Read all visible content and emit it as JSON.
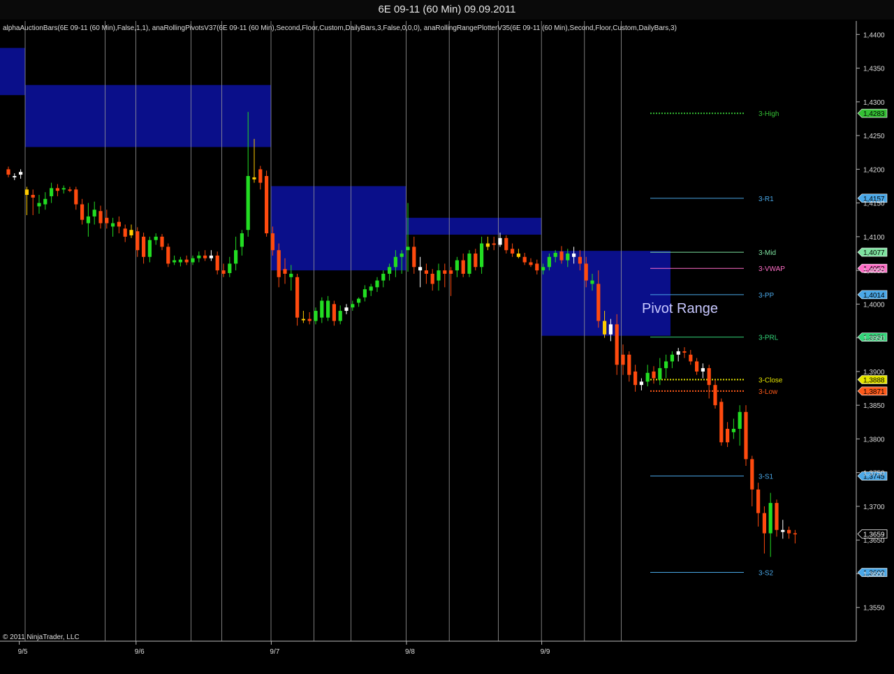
{
  "window": {
    "title": "6E 09-11 (60 Min)  09.09.2011"
  },
  "indicator_text": "alphaAuctionBars(6E 09-11 (60 Min),False,1,1), anaRollingPivotsV37(6E 09-11 (60 Min),Second,Floor,Custom,DailyBars,3,False,0,0,0), anaRollingRangePlotterV35(6E 09-11 (60 Min),Second,Floor,Custom,DailyBars,3)",
  "copyright": "© 2011 NinjaTrader, LLC",
  "annotation": "Pivot Range",
  "chart_data": {
    "type": "candlestick",
    "title": "6E 09-11 (60 Min)  09.09.2011",
    "y_axis": {
      "range": [
        1.35,
        1.442
      ],
      "ticks": [
        1.355,
        1.36,
        1.365,
        1.37,
        1.375,
        1.38,
        1.385,
        1.39,
        1.395,
        1.4,
        1.405,
        1.41,
        1.415,
        1.42,
        1.425,
        1.43,
        1.435,
        1.44
      ],
      "tick_labels": [
        "1,3550",
        "1,3600",
        "1,3650",
        "1,3700",
        "1,3750",
        "1,3800",
        "1,3850",
        "1,3900",
        "1,3950",
        "1,4000",
        "1,4050",
        "1,4100",
        "1,4150",
        "1,4200",
        "1,4250",
        "1,4300",
        "1,4350",
        "1,4400"
      ]
    },
    "x_axis": {
      "bar_count": 122,
      "date_labels": [
        {
          "label": "9/5",
          "bar": 2
        },
        {
          "label": "9/6",
          "bar": 21
        },
        {
          "label": "9/7",
          "bar": 43
        },
        {
          "label": "9/8",
          "bar": 65
        },
        {
          "label": "9/9",
          "bar": 87
        }
      ],
      "session_lines_bars": [
        3,
        16,
        21,
        30,
        35,
        43,
        50,
        56,
        65,
        72,
        80,
        87,
        94,
        100
      ]
    },
    "candles": [
      {
        "o": 1.42,
        "h": 1.4204,
        "l": 1.4188,
        "c": 1.4192,
        "color": "red"
      },
      {
        "o": 1.419,
        "h": 1.4194,
        "l": 1.4184,
        "c": 1.4188,
        "color": "white"
      },
      {
        "o": 1.4192,
        "h": 1.42,
        "l": 1.4186,
        "c": 1.4196,
        "color": "white"
      },
      {
        "o": 1.417,
        "h": 1.4174,
        "l": 1.4132,
        "c": 1.4162,
        "color": "yellow"
      },
      {
        "o": 1.4162,
        "h": 1.417,
        "l": 1.4132,
        "c": 1.4158,
        "color": "red"
      },
      {
        "o": 1.415,
        "h": 1.4162,
        "l": 1.4134,
        "c": 1.4145,
        "color": "green"
      },
      {
        "o": 1.4148,
        "h": 1.4166,
        "l": 1.414,
        "c": 1.4156,
        "color": "green"
      },
      {
        "o": 1.416,
        "h": 1.418,
        "l": 1.415,
        "c": 1.4172,
        "color": "green"
      },
      {
        "o": 1.4172,
        "h": 1.4178,
        "l": 1.416,
        "c": 1.4168,
        "color": "red"
      },
      {
        "o": 1.417,
        "h": 1.4176,
        "l": 1.4164,
        "c": 1.4172,
        "color": "green"
      },
      {
        "o": 1.417,
        "h": 1.4174,
        "l": 1.4166,
        "c": 1.4168,
        "color": "red"
      },
      {
        "o": 1.417,
        "h": 1.4174,
        "l": 1.414,
        "c": 1.4148,
        "color": "red"
      },
      {
        "o": 1.4148,
        "h": 1.4156,
        "l": 1.4118,
        "c": 1.4125,
        "color": "red"
      },
      {
        "o": 1.412,
        "h": 1.415,
        "l": 1.41,
        "c": 1.413,
        "color": "green"
      },
      {
        "o": 1.413,
        "h": 1.4152,
        "l": 1.4118,
        "c": 1.414,
        "color": "green"
      },
      {
        "o": 1.4138,
        "h": 1.4146,
        "l": 1.4112,
        "c": 1.412,
        "color": "red"
      },
      {
        "o": 1.4128,
        "h": 1.414,
        "l": 1.4112,
        "c": 1.412,
        "color": "red"
      },
      {
        "o": 1.412,
        "h": 1.4128,
        "l": 1.41,
        "c": 1.4115,
        "color": "green"
      },
      {
        "o": 1.4122,
        "h": 1.413,
        "l": 1.4105,
        "c": 1.4115,
        "color": "red"
      },
      {
        "o": 1.4112,
        "h": 1.4118,
        "l": 1.4092,
        "c": 1.41,
        "color": "red"
      },
      {
        "o": 1.411,
        "h": 1.4118,
        "l": 1.4098,
        "c": 1.4102,
        "color": "yellow"
      },
      {
        "o": 1.4108,
        "h": 1.4114,
        "l": 1.407,
        "c": 1.408,
        "color": "red"
      },
      {
        "o": 1.41,
        "h": 1.4106,
        "l": 1.406,
        "c": 1.407,
        "color": "red"
      },
      {
        "o": 1.407,
        "h": 1.41,
        "l": 1.4062,
        "c": 1.4095,
        "color": "green"
      },
      {
        "o": 1.4095,
        "h": 1.4105,
        "l": 1.4088,
        "c": 1.41,
        "color": "green"
      },
      {
        "o": 1.41,
        "h": 1.4104,
        "l": 1.408,
        "c": 1.4085,
        "color": "red"
      },
      {
        "o": 1.4085,
        "h": 1.409,
        "l": 1.4055,
        "c": 1.406,
        "color": "red"
      },
      {
        "o": 1.4065,
        "h": 1.4072,
        "l": 1.4058,
        "c": 1.4062,
        "color": "green"
      },
      {
        "o": 1.4062,
        "h": 1.407,
        "l": 1.4056,
        "c": 1.4066,
        "color": "green"
      },
      {
        "o": 1.4066,
        "h": 1.4072,
        "l": 1.4058,
        "c": 1.4062,
        "color": "red"
      },
      {
        "o": 1.4062,
        "h": 1.4072,
        "l": 1.4058,
        "c": 1.4068,
        "color": "green"
      },
      {
        "o": 1.4068,
        "h": 1.4078,
        "l": 1.4062,
        "c": 1.4072,
        "color": "green"
      },
      {
        "o": 1.4072,
        "h": 1.408,
        "l": 1.4064,
        "c": 1.4068,
        "color": "red"
      },
      {
        "o": 1.4068,
        "h": 1.408,
        "l": 1.4064,
        "c": 1.4072,
        "color": "white"
      },
      {
        "o": 1.4072,
        "h": 1.4078,
        "l": 1.4044,
        "c": 1.405,
        "color": "red"
      },
      {
        "o": 1.405,
        "h": 1.406,
        "l": 1.404,
        "c": 1.4045,
        "color": "red"
      },
      {
        "o": 1.4046,
        "h": 1.407,
        "l": 1.404,
        "c": 1.406,
        "color": "green"
      },
      {
        "o": 1.406,
        "h": 1.41,
        "l": 1.405,
        "c": 1.408,
        "color": "green"
      },
      {
        "o": 1.4085,
        "h": 1.411,
        "l": 1.4072,
        "c": 1.4105,
        "color": "green"
      },
      {
        "o": 1.411,
        "h": 1.4285,
        "l": 1.41,
        "c": 1.419,
        "color": "green"
      },
      {
        "o": 1.4188,
        "h": 1.4245,
        "l": 1.418,
        "c": 1.4185,
        "color": "yellow"
      },
      {
        "o": 1.42,
        "h": 1.4205,
        "l": 1.417,
        "c": 1.418,
        "color": "red"
      },
      {
        "o": 1.419,
        "h": 1.4198,
        "l": 1.41,
        "c": 1.4105,
        "color": "red"
      },
      {
        "o": 1.4105,
        "h": 1.4115,
        "l": 1.4072,
        "c": 1.408,
        "color": "red"
      },
      {
        "o": 1.408,
        "h": 1.409,
        "l": 1.4025,
        "c": 1.404,
        "color": "red"
      },
      {
        "o": 1.4052,
        "h": 1.4068,
        "l": 1.403,
        "c": 1.4045,
        "color": "red"
      },
      {
        "o": 1.4045,
        "h": 1.4058,
        "l": 1.402,
        "c": 1.404,
        "color": "green"
      },
      {
        "o": 1.404,
        "h": 1.4045,
        "l": 1.3968,
        "c": 1.398,
        "color": "red"
      },
      {
        "o": 1.3978,
        "h": 1.399,
        "l": 1.3972,
        "c": 1.3976,
        "color": "yellow"
      },
      {
        "o": 1.3978,
        "h": 1.3988,
        "l": 1.397,
        "c": 1.3975,
        "color": "red"
      },
      {
        "o": 1.3975,
        "h": 1.3995,
        "l": 1.397,
        "c": 1.399,
        "color": "green"
      },
      {
        "o": 1.398,
        "h": 1.401,
        "l": 1.3972,
        "c": 1.4005,
        "color": "green"
      },
      {
        "o": 1.4005,
        "h": 1.4012,
        "l": 1.3975,
        "c": 1.398,
        "color": "green"
      },
      {
        "o": 1.4,
        "h": 1.4005,
        "l": 1.3968,
        "c": 1.3975,
        "color": "red"
      },
      {
        "o": 1.3975,
        "h": 1.3998,
        "l": 1.397,
        "c": 1.399,
        "color": "green"
      },
      {
        "o": 1.399,
        "h": 1.4,
        "l": 1.3985,
        "c": 1.3995,
        "color": "white"
      },
      {
        "o": 1.3995,
        "h": 1.4005,
        "l": 1.399,
        "c": 1.4,
        "color": "green"
      },
      {
        "o": 1.4002,
        "h": 1.401,
        "l": 1.3996,
        "c": 1.4008,
        "color": "green"
      },
      {
        "o": 1.401,
        "h": 1.4028,
        "l": 1.4004,
        "c": 1.4022,
        "color": "green"
      },
      {
        "o": 1.402,
        "h": 1.403,
        "l": 1.4012,
        "c": 1.4026,
        "color": "green"
      },
      {
        "o": 1.4025,
        "h": 1.404,
        "l": 1.4018,
        "c": 1.4035,
        "color": "green"
      },
      {
        "o": 1.4035,
        "h": 1.405,
        "l": 1.4025,
        "c": 1.4045,
        "color": "green"
      },
      {
        "o": 1.4045,
        "h": 1.406,
        "l": 1.4035,
        "c": 1.4055,
        "color": "green"
      },
      {
        "o": 1.4055,
        "h": 1.408,
        "l": 1.404,
        "c": 1.407,
        "color": "green"
      },
      {
        "o": 1.407,
        "h": 1.408,
        "l": 1.4045,
        "c": 1.4075,
        "color": "green"
      },
      {
        "o": 1.408,
        "h": 1.415,
        "l": 1.4048,
        "c": 1.4085,
        "color": "green"
      },
      {
        "o": 1.4085,
        "h": 1.41,
        "l": 1.4045,
        "c": 1.4055,
        "color": "red"
      },
      {
        "o": 1.4055,
        "h": 1.407,
        "l": 1.4025,
        "c": 1.405,
        "color": "white"
      },
      {
        "o": 1.405,
        "h": 1.406,
        "l": 1.403,
        "c": 1.4045,
        "color": "red"
      },
      {
        "o": 1.4045,
        "h": 1.4052,
        "l": 1.402,
        "c": 1.403,
        "color": "red"
      },
      {
        "o": 1.4035,
        "h": 1.406,
        "l": 1.402,
        "c": 1.405,
        "color": "green"
      },
      {
        "o": 1.405,
        "h": 1.406,
        "l": 1.4025,
        "c": 1.4045,
        "color": "red"
      },
      {
        "o": 1.4045,
        "h": 1.4055,
        "l": 1.4012,
        "c": 1.405,
        "color": "red"
      },
      {
        "o": 1.405,
        "h": 1.407,
        "l": 1.404,
        "c": 1.4065,
        "color": "green"
      },
      {
        "o": 1.4065,
        "h": 1.4075,
        "l": 1.404,
        "c": 1.4045,
        "color": "red"
      },
      {
        "o": 1.4045,
        "h": 1.408,
        "l": 1.404,
        "c": 1.4075,
        "color": "green"
      },
      {
        "o": 1.4075,
        "h": 1.4082,
        "l": 1.405,
        "c": 1.4055,
        "color": "red"
      },
      {
        "o": 1.4055,
        "h": 1.41,
        "l": 1.4045,
        "c": 1.409,
        "color": "green"
      },
      {
        "o": 1.409,
        "h": 1.41,
        "l": 1.408,
        "c": 1.4085,
        "color": "yellow"
      },
      {
        "o": 1.4088,
        "h": 1.41,
        "l": 1.408,
        "c": 1.409,
        "color": "red"
      },
      {
        "o": 1.4088,
        "h": 1.4106,
        "l": 1.4085,
        "c": 1.4098,
        "color": "white"
      },
      {
        "o": 1.4098,
        "h": 1.4102,
        "l": 1.4075,
        "c": 1.408,
        "color": "red"
      },
      {
        "o": 1.4082,
        "h": 1.409,
        "l": 1.407,
        "c": 1.4075,
        "color": "red"
      },
      {
        "o": 1.4075,
        "h": 1.4082,
        "l": 1.4068,
        "c": 1.407,
        "color": "yellow"
      },
      {
        "o": 1.407,
        "h": 1.4076,
        "l": 1.4058,
        "c": 1.4062,
        "color": "red"
      },
      {
        "o": 1.4062,
        "h": 1.4068,
        "l": 1.4055,
        "c": 1.4058,
        "color": "red"
      },
      {
        "o": 1.406,
        "h": 1.4066,
        "l": 1.4044,
        "c": 1.405,
        "color": "red"
      },
      {
        "o": 1.405,
        "h": 1.406,
        "l": 1.4044,
        "c": 1.4055,
        "color": "green"
      },
      {
        "o": 1.4055,
        "h": 1.4075,
        "l": 1.405,
        "c": 1.407,
        "color": "green"
      },
      {
        "o": 1.407,
        "h": 1.408,
        "l": 1.4062,
        "c": 1.4076,
        "color": "green"
      },
      {
        "o": 1.4078,
        "h": 1.4086,
        "l": 1.406,
        "c": 1.4065,
        "color": "red"
      },
      {
        "o": 1.4065,
        "h": 1.4082,
        "l": 1.4055,
        "c": 1.4075,
        "color": "green"
      },
      {
        "o": 1.4075,
        "h": 1.4085,
        "l": 1.406,
        "c": 1.407,
        "color": "white"
      },
      {
        "o": 1.407,
        "h": 1.408,
        "l": 1.405,
        "c": 1.406,
        "color": "red"
      },
      {
        "o": 1.406,
        "h": 1.407,
        "l": 1.4025,
        "c": 1.4035,
        "color": "red"
      },
      {
        "o": 1.4035,
        "h": 1.4045,
        "l": 1.402,
        "c": 1.403,
        "color": "green"
      },
      {
        "o": 1.403,
        "h": 1.405,
        "l": 1.3965,
        "c": 1.3975,
        "color": "red"
      },
      {
        "o": 1.3975,
        "h": 1.399,
        "l": 1.395,
        "c": 1.3955,
        "color": "yellow"
      },
      {
        "o": 1.3955,
        "h": 1.3978,
        "l": 1.3945,
        "c": 1.397,
        "color": "white"
      },
      {
        "o": 1.397,
        "h": 1.3985,
        "l": 1.3895,
        "c": 1.391,
        "color": "red"
      },
      {
        "o": 1.391,
        "h": 1.394,
        "l": 1.3895,
        "c": 1.3925,
        "color": "red"
      },
      {
        "o": 1.3925,
        "h": 1.393,
        "l": 1.3885,
        "c": 1.3895,
        "color": "red"
      },
      {
        "o": 1.39,
        "h": 1.391,
        "l": 1.387,
        "c": 1.388,
        "color": "red"
      },
      {
        "o": 1.388,
        "h": 1.389,
        "l": 1.3872,
        "c": 1.3885,
        "color": "white"
      },
      {
        "o": 1.3885,
        "h": 1.391,
        "l": 1.3878,
        "c": 1.3898,
        "color": "green"
      },
      {
        "o": 1.39,
        "h": 1.3908,
        "l": 1.3882,
        "c": 1.389,
        "color": "red"
      },
      {
        "o": 1.3888,
        "h": 1.392,
        "l": 1.388,
        "c": 1.3905,
        "color": "green"
      },
      {
        "o": 1.3905,
        "h": 1.3925,
        "l": 1.389,
        "c": 1.3915,
        "color": "green"
      },
      {
        "o": 1.3915,
        "h": 1.393,
        "l": 1.3905,
        "c": 1.3925,
        "color": "green"
      },
      {
        "o": 1.3925,
        "h": 1.3935,
        "l": 1.3915,
        "c": 1.393,
        "color": "white"
      },
      {
        "o": 1.393,
        "h": 1.3936,
        "l": 1.392,
        "c": 1.3928,
        "color": "red"
      },
      {
        "o": 1.3925,
        "h": 1.3932,
        "l": 1.391,
        "c": 1.3915,
        "color": "red"
      },
      {
        "o": 1.3915,
        "h": 1.392,
        "l": 1.3895,
        "c": 1.39,
        "color": "red"
      },
      {
        "o": 1.39,
        "h": 1.3912,
        "l": 1.389,
        "c": 1.3905,
        "color": "white"
      },
      {
        "o": 1.3905,
        "h": 1.391,
        "l": 1.386,
        "c": 1.388,
        "color": "red"
      },
      {
        "o": 1.388,
        "h": 1.3888,
        "l": 1.3845,
        "c": 1.385,
        "color": "red"
      },
      {
        "o": 1.3855,
        "h": 1.386,
        "l": 1.379,
        "c": 1.3795,
        "color": "red"
      },
      {
        "o": 1.3795,
        "h": 1.3825,
        "l": 1.3788,
        "c": 1.3815,
        "color": "red"
      },
      {
        "o": 1.3815,
        "h": 1.383,
        "l": 1.38,
        "c": 1.381,
        "color": "green"
      },
      {
        "o": 1.3815,
        "h": 1.385,
        "l": 1.379,
        "c": 1.384,
        "color": "green"
      },
      {
        "o": 1.384,
        "h": 1.385,
        "l": 1.376,
        "c": 1.377,
        "color": "red"
      }
    ],
    "tail_candles": [
      {
        "o": 1.377,
        "h": 1.3775,
        "l": 1.37,
        "c": 1.3725,
        "color": "red"
      },
      {
        "o": 1.3725,
        "h": 1.3735,
        "l": 1.367,
        "c": 1.369,
        "color": "red"
      },
      {
        "o": 1.369,
        "h": 1.37,
        "l": 1.363,
        "c": 1.366,
        "color": "red"
      },
      {
        "o": 1.366,
        "h": 1.372,
        "l": 1.3625,
        "c": 1.3705,
        "color": "green"
      },
      {
        "o": 1.3705,
        "h": 1.371,
        "l": 1.3655,
        "c": 1.3665,
        "color": "red"
      },
      {
        "o": 1.3665,
        "h": 1.368,
        "l": 1.3652,
        "c": 1.3662,
        "color": "white"
      },
      {
        "o": 1.3665,
        "h": 1.367,
        "l": 1.3652,
        "c": 1.366,
        "color": "red"
      },
      {
        "o": 1.366,
        "h": 1.3665,
        "l": 1.3645,
        "c": 1.3659,
        "color": "red"
      }
    ],
    "auction_boxes": [
      {
        "bar_start": 0,
        "bar_end": 3,
        "top": 1.438,
        "bottom": 1.431
      },
      {
        "bar_start": 3,
        "bar_end": 43,
        "top": 1.4325,
        "bottom": 1.4233
      },
      {
        "bar_start": 43,
        "bar_end": 65,
        "top": 1.4175,
        "bottom": 1.405
      },
      {
        "bar_start": 65,
        "bar_end": 87,
        "top": 1.4128,
        "bottom": 1.4103
      },
      {
        "bar_start": 87,
        "bar_end": 108,
        "top": 1.4079,
        "bottom": 1.3953
      }
    ],
    "pivot_levels": [
      {
        "name": "3-High",
        "value": 1.4283,
        "label": "1,4283",
        "color": "#34c034",
        "style": "dotted"
      },
      {
        "name": "3-R1",
        "value": 1.4157,
        "label": "1,4157",
        "color": "#4aa8e8",
        "style": "solid"
      },
      {
        "name": "3-Mid",
        "value": 1.4077,
        "label": "1,4077",
        "color": "#7ee3a0",
        "style": "solid"
      },
      {
        "name": "3-VWAP",
        "value": 1.4053,
        "label": "1,4053",
        "color": "#ff6ec7",
        "style": "solid"
      },
      {
        "name": "3-PP",
        "value": 1.4014,
        "label": "1,4014",
        "color": "#4aa8e8",
        "style": "solid"
      },
      {
        "name": "3-PRL",
        "value": 1.3951,
        "label": "1,3951",
        "color": "#34d67a",
        "style": "solid"
      },
      {
        "name": "3-Close",
        "value": 1.3888,
        "label": "1,3888",
        "color": "#e6e600",
        "style": "dotted"
      },
      {
        "name": "3-Low",
        "value": 1.3871,
        "label": "1,3871",
        "color": "#ff5a1a",
        "style": "dotted"
      },
      {
        "name": "3-S1",
        "value": 1.3745,
        "label": "1,3745",
        "color": "#4aa8e8",
        "style": "solid"
      },
      {
        "name": "3-S2",
        "value": 1.3602,
        "label": "1,3602",
        "color": "#4aa8e8",
        "style": "solid"
      }
    ],
    "current_price": {
      "value": 1.3659,
      "label": "1,3659"
    },
    "grid": false
  }
}
